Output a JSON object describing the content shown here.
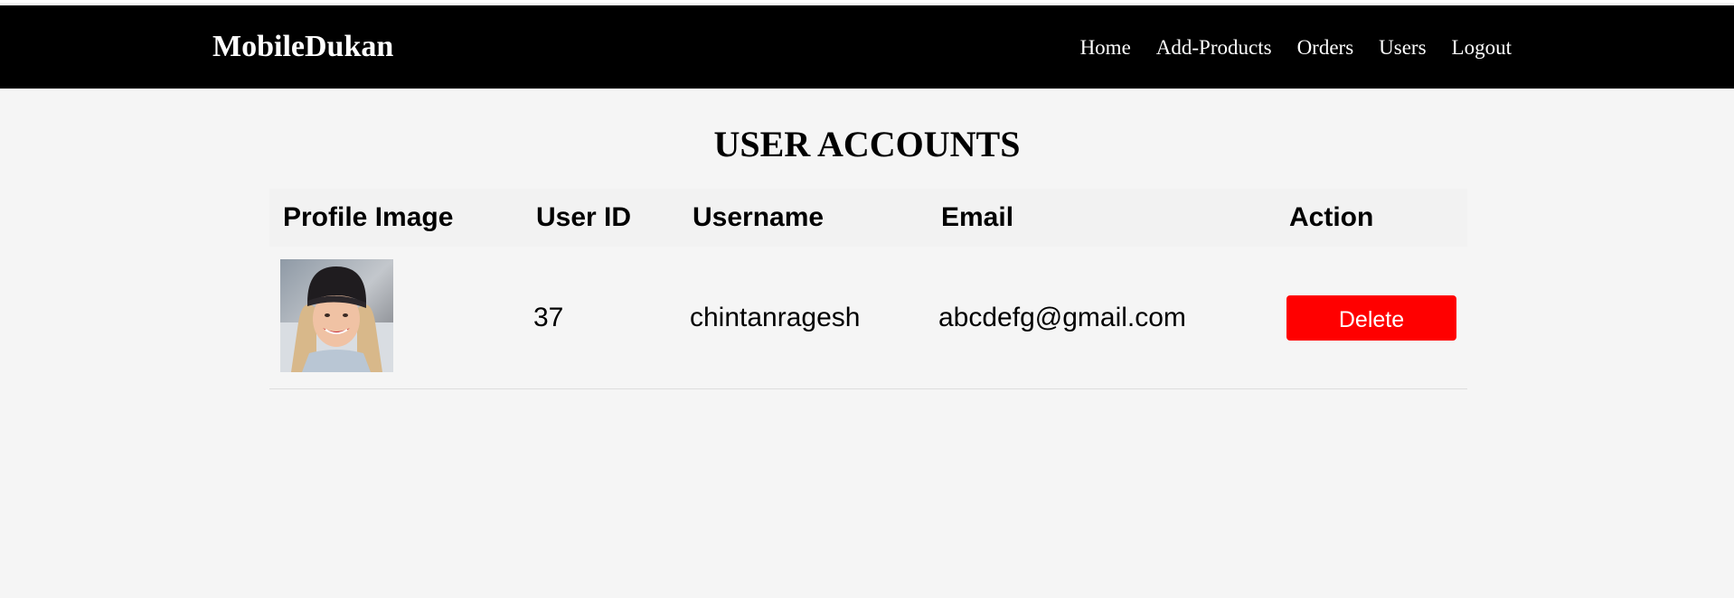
{
  "navbar": {
    "brand": "MobileDukan",
    "links": [
      "Home",
      "Add-Products",
      "Orders",
      "Users",
      "Logout"
    ]
  },
  "page": {
    "title": "USER ACCOUNTS"
  },
  "table": {
    "headers": [
      "Profile Image",
      "User ID",
      "Username",
      "Email",
      "Action"
    ],
    "rows": [
      {
        "user_id": "37",
        "username": "chintanragesh",
        "email": "abcdefg@gmail.com",
        "action_label": "Delete"
      }
    ]
  },
  "colors": {
    "navbar_bg": "#000000",
    "page_bg": "#f5f5f5",
    "header_row_bg": "#f2f2f2",
    "delete_button": "#ff0000"
  }
}
